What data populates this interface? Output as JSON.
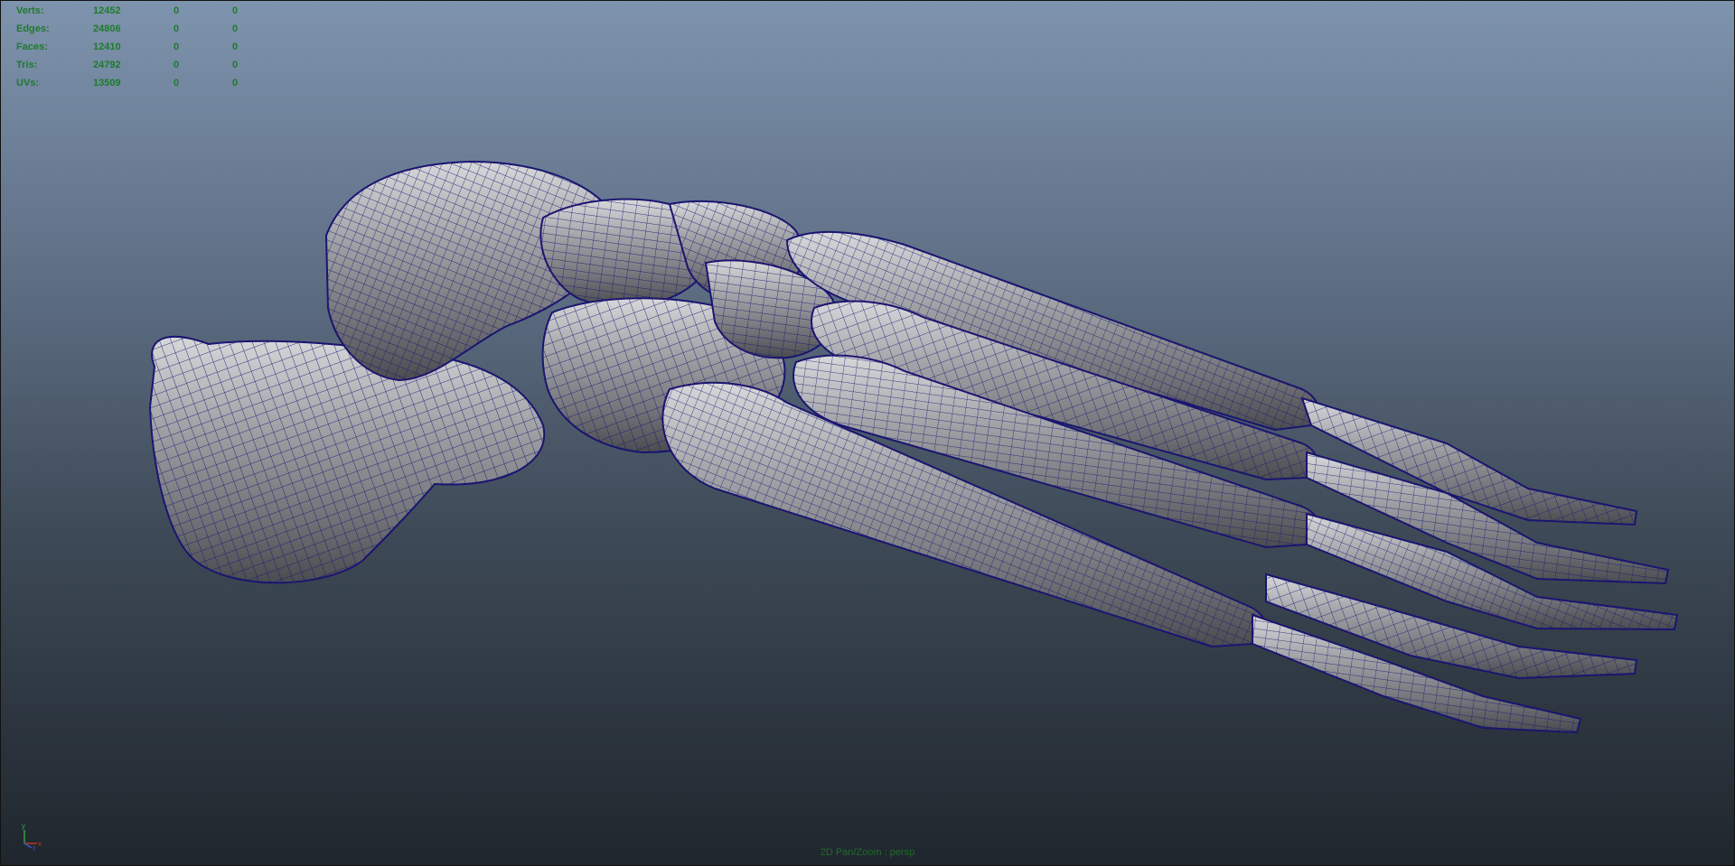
{
  "hud": {
    "rows": [
      {
        "label": "Verts:",
        "c1": "12452",
        "c2": "0",
        "c3": "0"
      },
      {
        "label": "Edges:",
        "c1": "24806",
        "c2": "0",
        "c3": "0"
      },
      {
        "label": "Faces:",
        "c1": "12410",
        "c2": "0",
        "c3": "0"
      },
      {
        "label": "Tris:",
        "c1": "24792",
        "c2": "0",
        "c3": "0"
      },
      {
        "label": "UVs:",
        "c1": "13509",
        "c2": "0",
        "c3": "0"
      }
    ]
  },
  "viewport": {
    "camera_label": "2D Pan/Zoom : persp",
    "axis_labels": {
      "y": "y",
      "x": "x",
      "z": "z"
    }
  },
  "colors": {
    "hud_text": "#1f7a2e",
    "wire": "#1a1570",
    "bone": "#8d8f93"
  },
  "icons": {
    "axis": "xyz-axis-indicator-icon"
  }
}
